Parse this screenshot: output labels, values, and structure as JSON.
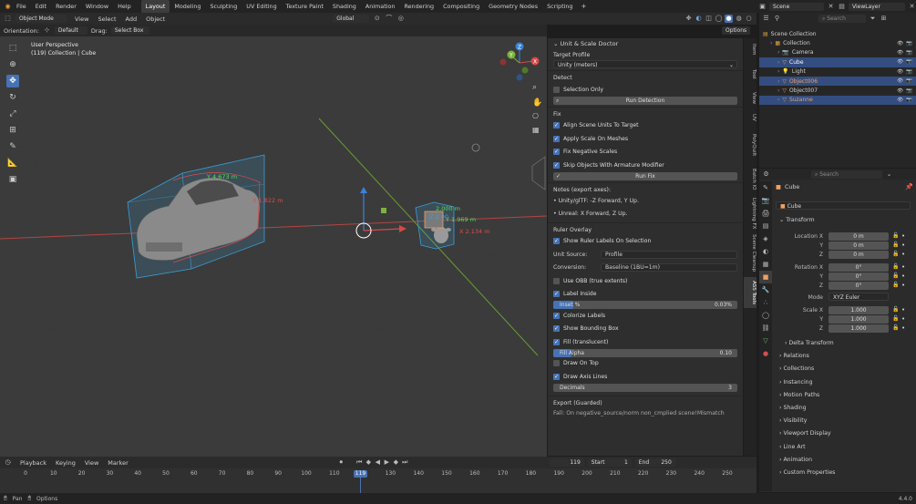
{
  "menu": [
    "File",
    "Edit",
    "Render",
    "Window",
    "Help"
  ],
  "workspaces": [
    "Layout",
    "Modeling",
    "Sculpting",
    "UV Editing",
    "Texture Paint",
    "Shading",
    "Animation",
    "Rendering",
    "Compositing",
    "Geometry Nodes",
    "Scripting"
  ],
  "workspace_add": "+",
  "scene": {
    "name": "Scene",
    "view_layer": "ViewLayer"
  },
  "viewport_header": {
    "mode": "Object Mode",
    "menus": [
      "View",
      "Select",
      "Add",
      "Object"
    ],
    "transform_orientation": "Global"
  },
  "tool_header": {
    "orientation_label": "Orientation:",
    "orientation": "Default",
    "drag_label": "Drag:",
    "drag": "Select Box",
    "options": "Options"
  },
  "viewport": {
    "perspective": "User Perspective",
    "collection_info": "(119) Collection | Cube",
    "labels": {
      "car_y": "Y 4.673 m",
      "car_x": "X 1.822 m",
      "cube_z": "2.000 m",
      "cube_y": "Y 1.969 m",
      "cube_x": "X 2.134 m",
      "cube_z2": "Z 2.00"
    }
  },
  "nav_gizmo": {
    "x": "X",
    "y": "Y",
    "z": "Z"
  },
  "npanel": {
    "title": "Unit & Scale Doctor",
    "target_profile_label": "Target Profile",
    "target_profile": "Unity (meters)",
    "detect_label": "Detect",
    "selection_only": "Selection Only",
    "run_detection": "Run Detection",
    "fix_label": "Fix",
    "fix_options": [
      "Align Scene Units To Target",
      "Apply Scale On Meshes",
      "Fix Negative Scales",
      "Skip Objects With Armature Modifier"
    ],
    "run_fix": "Run Fix",
    "notes_label": "Notes (export axes):",
    "notes": [
      "• Unity/glTF: -Z Forward, Y Up.",
      "• Unreal: X Forward, Z Up."
    ],
    "ruler_label": "Ruler Overlay",
    "show_ruler": "Show Ruler Labels On Selection",
    "unit_source_label": "Unit Source:",
    "unit_source": "Profile",
    "conversion_label": "Conversion:",
    "conversion": "Baseline (1BU=1m)",
    "use_obb": "Use OBB (true extents)",
    "label_inside": "Label Inside",
    "inset_label": "Inset %",
    "inset_value": "0.03%",
    "inset_fraction": 0.11,
    "colorize": "Colorize Labels",
    "show_bbox": "Show Bounding Box",
    "fill_translucent": "Fill (translucent)",
    "fill_alpha_label": "Fill Alpha",
    "fill_alpha_value": "0.10",
    "fill_alpha_fraction": 0.1,
    "draw_on_top": "Draw On Top",
    "draw_axis": "Draw Axis Lines",
    "decimals_label": "Decimals",
    "decimals_value": "3",
    "export_label": "Export (Guarded)",
    "export_row": "Fall: On     negative_source/norm non_cmplied scene!Mismatch"
  },
  "npanel_tabs": [
    "Item",
    "Tool",
    "View",
    "UV",
    "PolyQuilt",
    "Batch IO",
    "Lightning FX",
    "Scene Cleanup",
    "ASS Tools"
  ],
  "outliner": {
    "search_placeholder": "Search",
    "items": [
      {
        "label": "Scene Collection",
        "indent": 0,
        "icon": "scene-collection-icon",
        "selected": false,
        "color": "#d0d0d0"
      },
      {
        "label": "Collection",
        "indent": 1,
        "icon": "collection-icon",
        "selected": false,
        "color": "#d0d0d0"
      },
      {
        "label": "Camera",
        "indent": 2,
        "icon": "camera-icon",
        "selected": false,
        "color": "#d0d0d0"
      },
      {
        "label": "Cube",
        "indent": 2,
        "icon": "mesh-icon",
        "selected": true,
        "color": "#ffffff"
      },
      {
        "label": "Light",
        "indent": 2,
        "icon": "light-icon",
        "selected": false,
        "color": "#d0d0d0"
      },
      {
        "label": "Object006",
        "indent": 2,
        "icon": "mesh-icon",
        "selected": true,
        "color": "#f0a060"
      },
      {
        "label": "Object007",
        "indent": 2,
        "icon": "mesh-icon",
        "selected": false,
        "color": "#d0d0d0"
      },
      {
        "label": "Suzanne",
        "indent": 2,
        "icon": "mesh-icon",
        "selected": true,
        "color": "#f0a060"
      }
    ]
  },
  "properties": {
    "search_placeholder": "Search",
    "object_name": "Cube",
    "object_field": "Cube",
    "transform_label": "Transform",
    "location_label": "Location X",
    "location": [
      "0 m",
      "0 m",
      "0 m"
    ],
    "rotation_label": "Rotation X",
    "rotation": [
      "0°",
      "0°",
      "0°"
    ],
    "mode_label": "Mode",
    "mode": "XYZ Euler",
    "scale_label": "Scale X",
    "scale": [
      "1.000",
      "1.000",
      "1.000"
    ],
    "axis_y": "Y",
    "axis_z": "Z",
    "sections": [
      "Delta Transform",
      "Relations",
      "Collections",
      "Instancing",
      "Motion Paths",
      "Shading",
      "Visibility",
      "Viewport Display",
      "Line Art",
      "Animation",
      "Custom Properties"
    ]
  },
  "timeline": {
    "menus": [
      "Playback",
      "Keying",
      "View",
      "Marker"
    ],
    "current_frame": "119",
    "start_label": "Start",
    "start": "1",
    "end_label": "End",
    "end": "250",
    "ticks": [
      "0",
      "10",
      "20",
      "30",
      "40",
      "50",
      "60",
      "70",
      "80",
      "90",
      "100",
      "110",
      "120",
      "130",
      "140",
      "150",
      "160",
      "170",
      "180",
      "190",
      "200",
      "210",
      "220",
      "230",
      "240",
      "250"
    ]
  },
  "status": {
    "pan": "Pan",
    "options": "Options",
    "version": "4.4.0"
  },
  "colors": {
    "accent": "#4772b3",
    "selected_orange": "#f0a060",
    "bbox_blue": "#3d9ed8",
    "axis_red": "#d84848",
    "axis_green": "#7bb33c"
  }
}
